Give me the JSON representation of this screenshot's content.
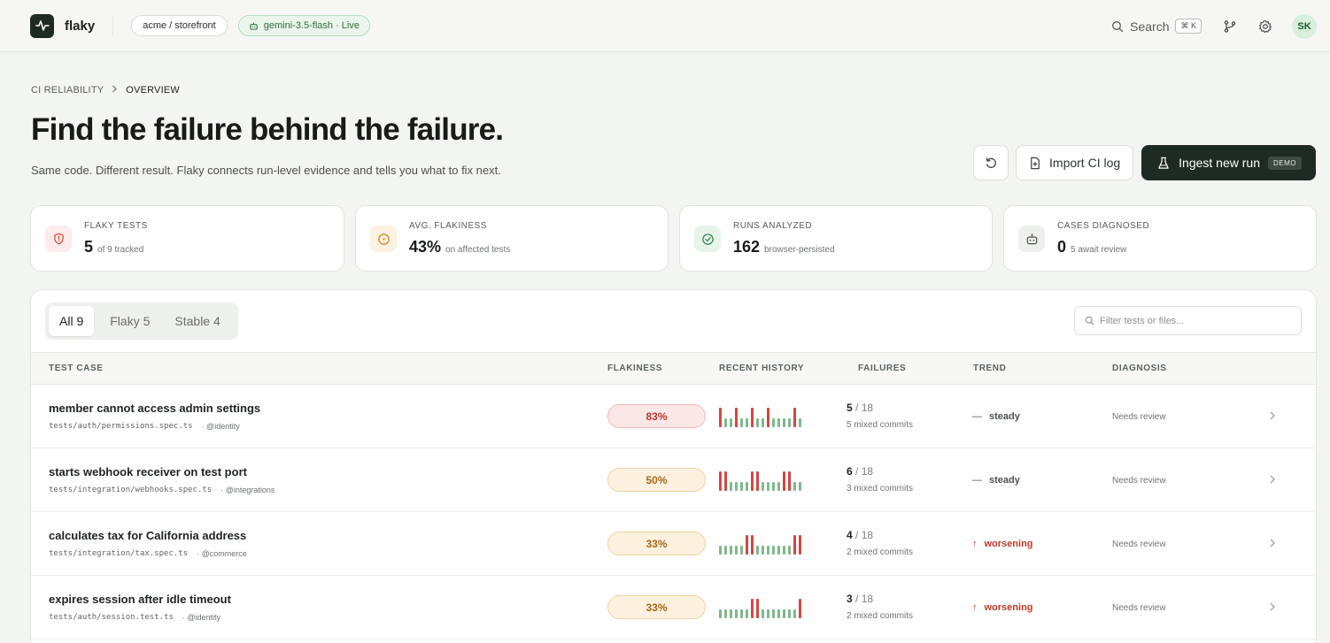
{
  "app": {
    "brand": "flaky",
    "repo": "acme / storefront",
    "model_status": "gemini-3.5-flash · Live",
    "search_label": "Search",
    "search_shortcut": "⌘ K",
    "user_initials": "SK"
  },
  "breadcrumb": {
    "section": "CI RELIABILITY",
    "separator": ">",
    "current": "OVERVIEW"
  },
  "header": {
    "title": "Find the failure behind the failure.",
    "subtitle": "Same code. Different result. Flaky connects run-level evidence and tells you what to fix next."
  },
  "actions": {
    "import_label": "Import CI log",
    "ingest_label": "Ingest new run",
    "ingest_badge": "DEMO"
  },
  "stats": [
    {
      "label": "FLAKY TESTS",
      "value": "5",
      "sub": "of 9 tracked",
      "icon": "shield-alert-icon",
      "color": "#d9473e",
      "bg": "#fdeceb"
    },
    {
      "label": "AVG. FLAKINESS",
      "value": "43%",
      "sub": "on affected tests",
      "icon": "target-icon",
      "color": "#d18a1f",
      "bg": "#fdf1e1"
    },
    {
      "label": "RUNS ANALYZED",
      "value": "162",
      "sub": "browser-persisted",
      "icon": "check-circle-icon",
      "color": "#3a8a4c",
      "bg": "#e8f4ea"
    },
    {
      "label": "CASES DIAGNOSED",
      "value": "0",
      "sub": "5 await review",
      "icon": "bot-icon",
      "color": "#4b524d",
      "bg": "#eef0ed"
    }
  ],
  "tabs": [
    {
      "label": "All",
      "count": "9"
    },
    {
      "label": "Flaky",
      "count": "5"
    },
    {
      "label": "Stable",
      "count": "4"
    }
  ],
  "filter": {
    "placeholder": "Filter tests or files..."
  },
  "columns": {
    "test_case": "TEST CASE",
    "flakiness": "FLAKINESS",
    "history": "RECENT HISTORY",
    "failures": "FAILURES",
    "trend": "TREND",
    "diagnosis": "DIAGNOSIS"
  },
  "colors": {
    "fail": "#d64541",
    "pass": "#7fb88d",
    "accent": "#1e2b22"
  },
  "rows": [
    {
      "name": "member cannot access admin settings",
      "file": "tests/auth/permissions.spec.ts",
      "owner": "· @identity",
      "flakiness": "83%",
      "severity": "red",
      "history": [
        1,
        0,
        0,
        1,
        0,
        0,
        1,
        0,
        0,
        1,
        0,
        0,
        0,
        0,
        1,
        0
      ],
      "failures": "5",
      "total": "/ 18",
      "mixed": "5 mixed commits",
      "trend": "steady",
      "trend_glyph": "—",
      "diagnosis": "Needs review"
    },
    {
      "name": "starts webhook receiver on test port",
      "file": "tests/integration/webhooks.spec.ts",
      "owner": "· @integrations",
      "flakiness": "50%",
      "severity": "amber",
      "history": [
        1,
        1,
        0,
        0,
        0,
        0,
        1,
        1,
        0,
        0,
        0,
        0,
        1,
        1,
        0,
        0
      ],
      "failures": "6",
      "total": "/ 18",
      "mixed": "3 mixed commits",
      "trend": "steady",
      "trend_glyph": "—",
      "diagnosis": "Needs review"
    },
    {
      "name": "calculates tax for California address",
      "file": "tests/integration/tax.spec.ts",
      "owner": "· @commerce",
      "flakiness": "33%",
      "severity": "amber",
      "history": [
        0,
        0,
        0,
        0,
        0,
        1,
        1,
        0,
        0,
        0,
        0,
        0,
        0,
        0,
        1,
        1
      ],
      "failures": "4",
      "total": "/ 18",
      "mixed": "2 mixed commits",
      "trend": "worsening",
      "trend_glyph": "↑",
      "diagnosis": "Needs review"
    },
    {
      "name": "expires session after idle timeout",
      "file": "tests/auth/session.test.ts",
      "owner": "· @identity",
      "flakiness": "33%",
      "severity": "amber",
      "history": [
        0,
        0,
        0,
        0,
        0,
        0,
        1,
        1,
        0,
        0,
        0,
        0,
        0,
        0,
        0,
        1
      ],
      "failures": "3",
      "total": "/ 18",
      "mixed": "2 mixed commits",
      "trend": "worsening",
      "trend_glyph": "↑",
      "diagnosis": "Needs review"
    }
  ]
}
